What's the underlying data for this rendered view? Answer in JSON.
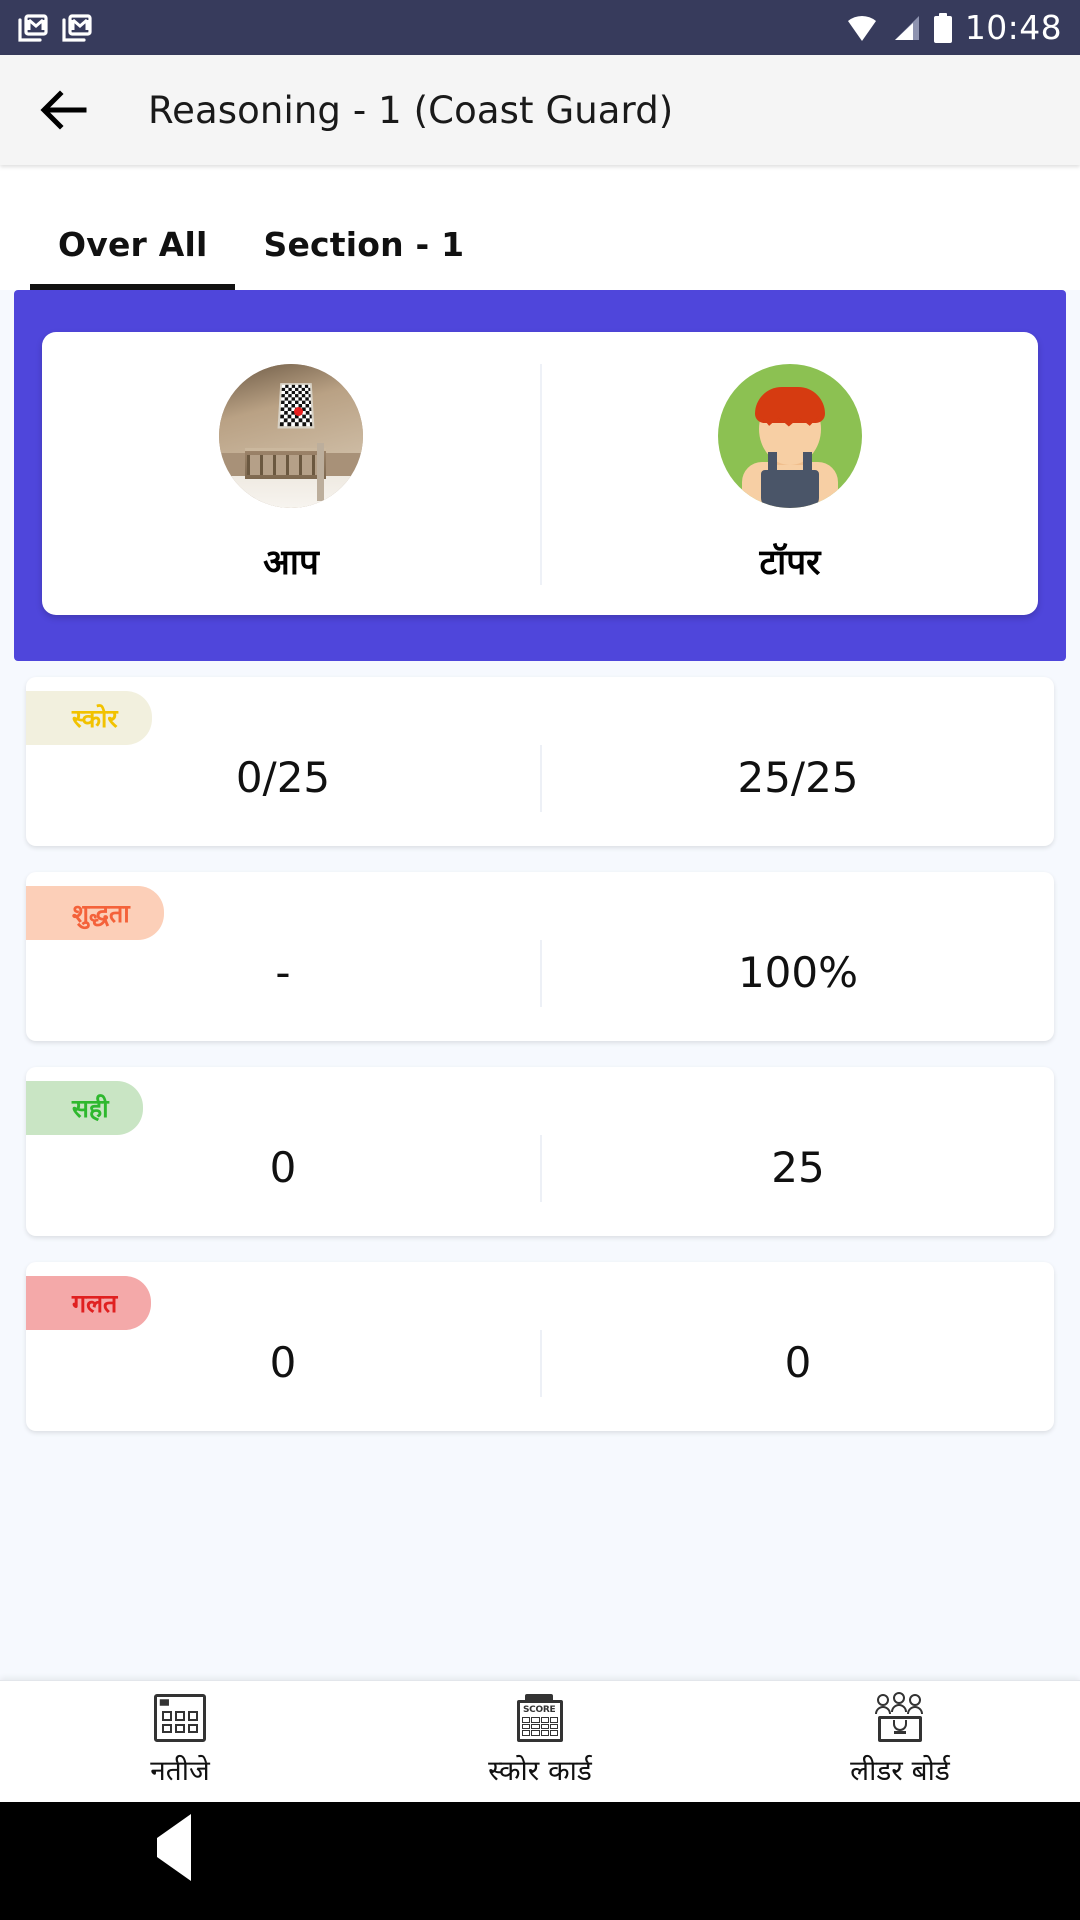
{
  "status_bar": {
    "notification_icons": [
      "gmail-icon",
      "gmail-icon"
    ],
    "wifi_icon": "wifi-icon",
    "signal_icon": "cellular-signal-icon",
    "battery_icon": "battery-full-icon",
    "time": "10:48",
    "background_color": "#373B5C"
  },
  "app_bar": {
    "back_icon": "back-arrow-icon",
    "title": "Reasoning - 1 (Coast Guard)",
    "background_color": "#F5F5F5"
  },
  "tabs": [
    {
      "label": "Over All",
      "active": true
    },
    {
      "label": "Section - 1",
      "active": false
    }
  ],
  "hero": {
    "background_color": "#4F46DB",
    "columns": [
      {
        "avatar": "user-photo-avatar",
        "label": "आप"
      },
      {
        "avatar": "topper-cartoon-avatar",
        "label": "टॉपर"
      }
    ]
  },
  "stats": [
    {
      "badge_label": "स्कोर",
      "badge_bg": "#F2F0DE",
      "badge_color": "#F2C200",
      "you": "0/25",
      "topper": "25/25"
    },
    {
      "badge_label": "शुद्धता",
      "badge_bg": "#FCCFB8",
      "badge_color": "#F4623A",
      "you": "-",
      "topper": "100%"
    },
    {
      "badge_label": "सही",
      "badge_bg": "#C9E5C4",
      "badge_color": "#2EB82E",
      "you": "0",
      "topper": "25"
    },
    {
      "badge_label": "गलत",
      "badge_bg": "#F4A9A9",
      "badge_color": "#E02020",
      "you": "0",
      "topper": "0"
    }
  ],
  "bottom_nav": [
    {
      "icon": "results-grid-icon",
      "label": "नतीजे"
    },
    {
      "icon": "score-card-icon",
      "label": "स्कोर कार्ड"
    },
    {
      "icon": "leaderboard-icon",
      "label": "लीडर बोर्ड"
    }
  ],
  "android_nav": {
    "back": "nav-back-triangle-icon",
    "home": "nav-home-circle-icon",
    "recents": "nav-recents-square-icon"
  }
}
